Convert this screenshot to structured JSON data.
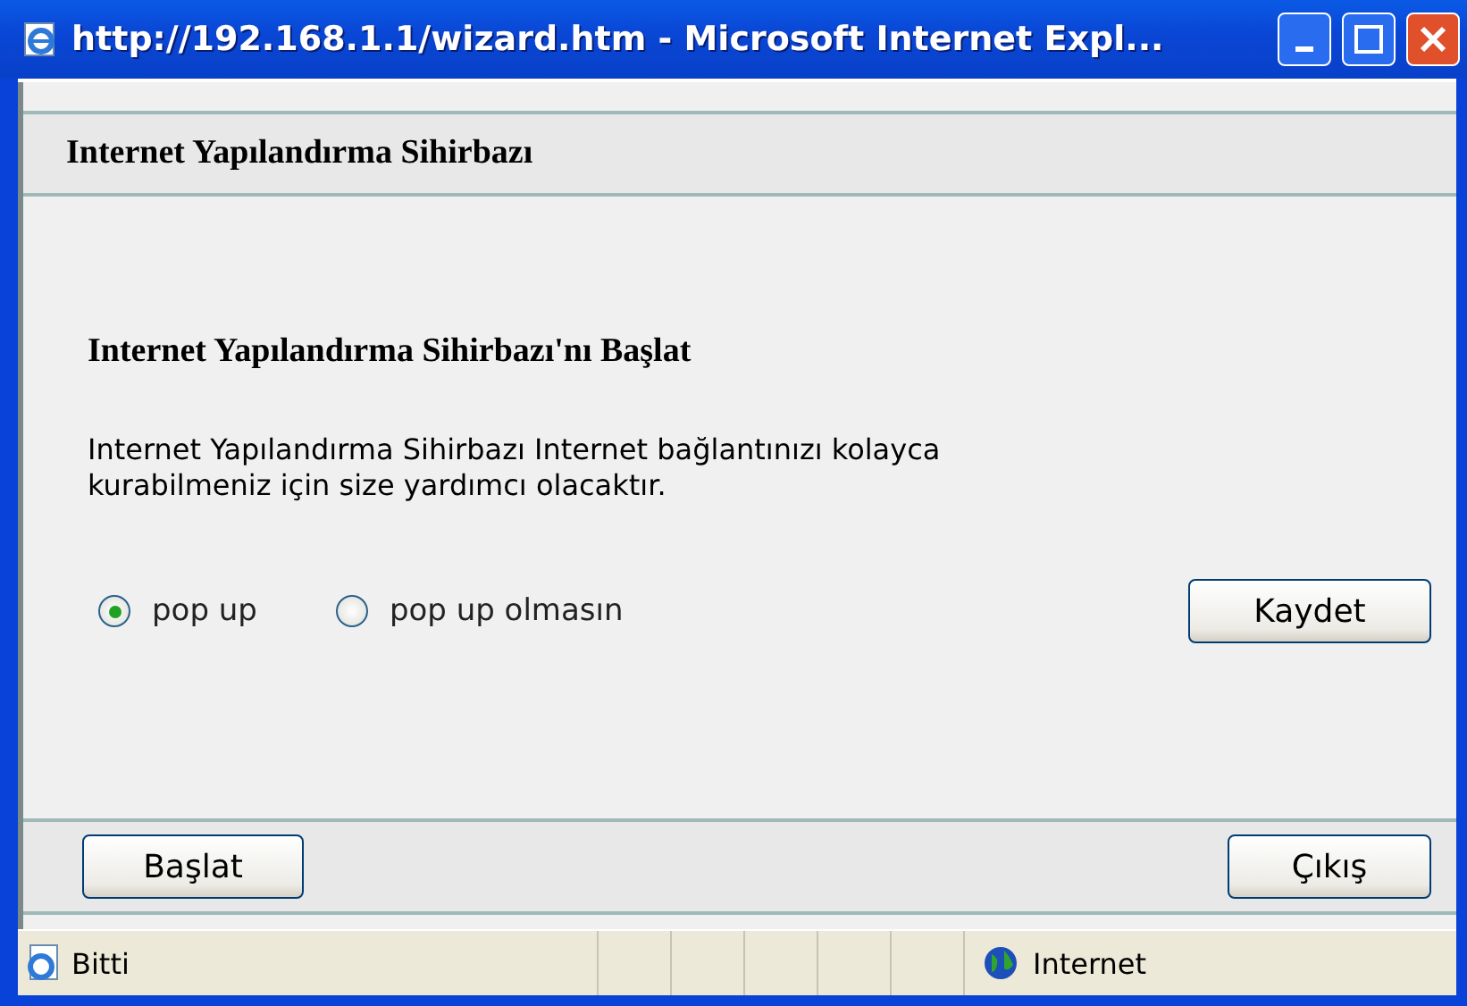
{
  "window": {
    "title": "http://192.168.1.1/wizard.htm - Microsoft Internet Expl..."
  },
  "header": {
    "title": "Internet Yapılandırma Sihirbazı"
  },
  "content": {
    "heading": "Internet Yapılandırma Sihirbazı'nı Başlat",
    "description": "Internet Yapılandırma Sihirbazı Internet bağlantınızı kolayca kurabilmeniz için size yardımcı olacaktır.",
    "options": [
      {
        "label": "pop up",
        "selected": true
      },
      {
        "label": "pop up olmasın",
        "selected": false
      }
    ],
    "save_button": "Kaydet"
  },
  "footer": {
    "buttons": [
      "Başlat",
      "Çıkış"
    ]
  },
  "status_bar": {
    "text": "Bitti",
    "zone": "Internet"
  }
}
